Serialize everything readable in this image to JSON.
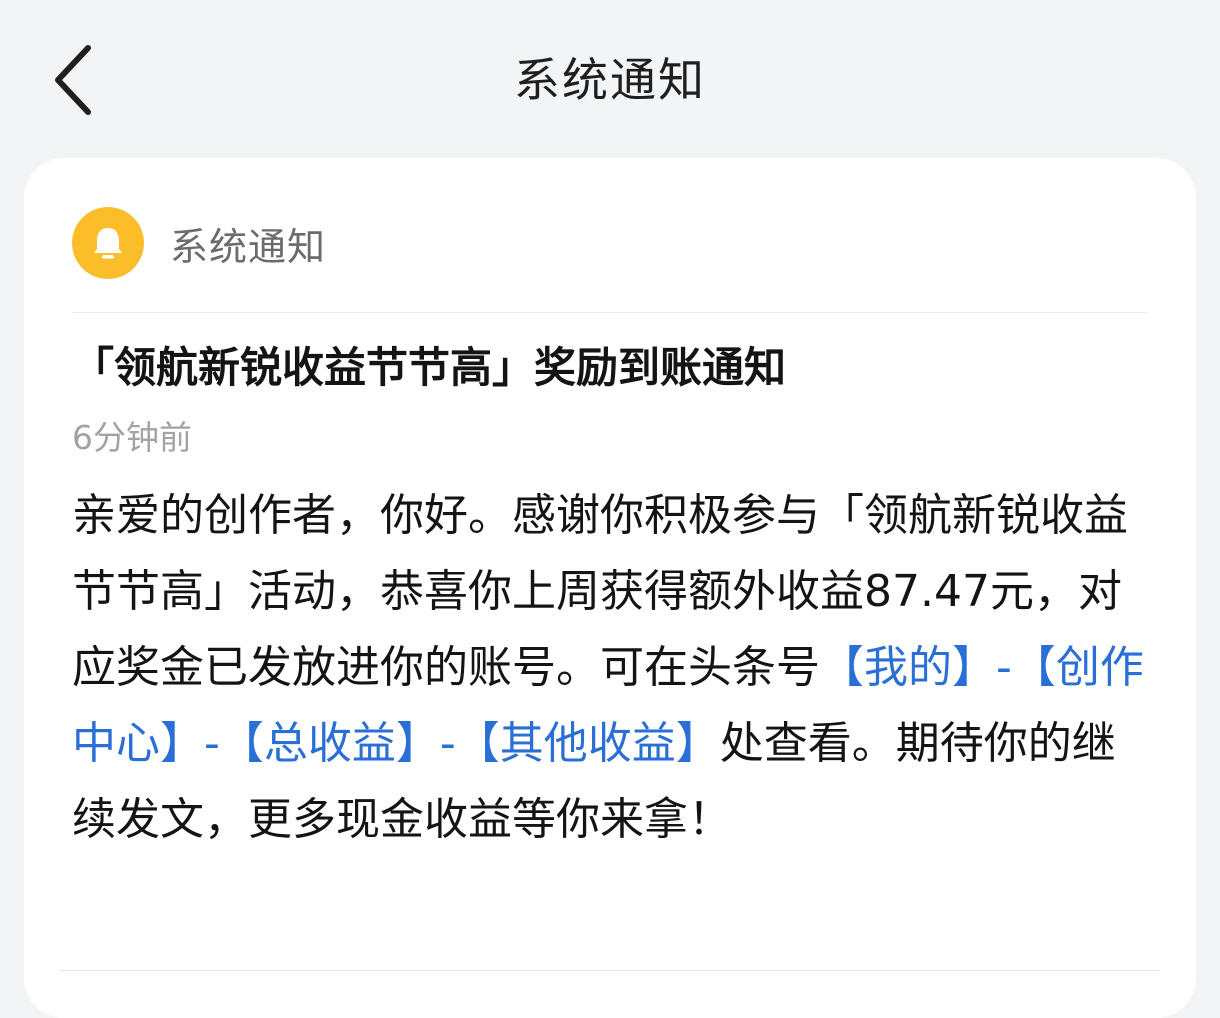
{
  "header": {
    "title": "系统通知"
  },
  "card": {
    "sender": {
      "icon": "bell-icon",
      "name": "系统通知",
      "color": "#fbbd2a"
    },
    "title": "「领航新锐收益节节高」奖励到账通知",
    "time": "6分钟前",
    "body": {
      "text_1": "亲爱的创作者，你好。感谢你积极参与「领航新锐收益节节高」活动，恭喜你上周获得额外收益87.47元，对应奖金已发放进你的账号。可在头条号",
      "link_1": "【我的】",
      "sep_1": "-",
      "link_2": "【创作中心】",
      "sep_2": "-",
      "link_3": "【总收益】",
      "sep_3": "-",
      "link_4": "【其他收益】",
      "text_2": "处查看。期待你的继续发文，更多现金收益等你来拿！"
    }
  },
  "colors": {
    "link": "#2a6fd6",
    "background": "#f3f4f6"
  }
}
